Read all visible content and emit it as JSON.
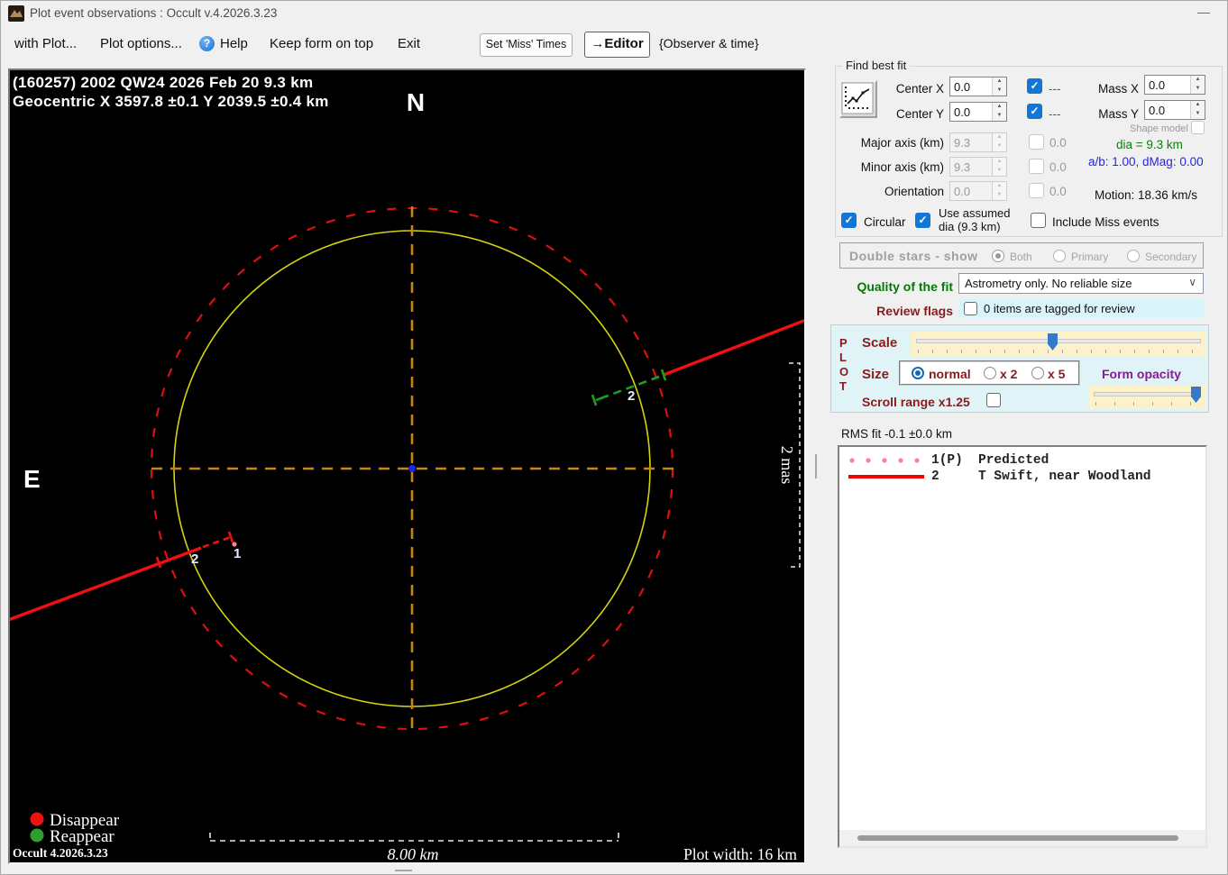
{
  "icons": {
    "help_glyph": "?",
    "check_glyph": "✓",
    "spinner_up": "▲",
    "spinner_down": "▼",
    "combo_chevron": "∨",
    "minimize": "—"
  },
  "window": {
    "title": "Plot event observations : Occult v.4.2026.3.23"
  },
  "menubar": {
    "with_plot": "with Plot...",
    "plot_options": "Plot options...",
    "help": "Help",
    "keep_on_top": "Keep form on top",
    "exit": "Exit",
    "set_miss_times": "Set 'Miss' Times",
    "editor": "→Editor",
    "observer_time": "{Observer & time}"
  },
  "plot": {
    "header_line1": "(160257) 2002 QW24  2026 Feb 20   9.3 km",
    "header_line2": "Geocentric  X 3597.8 ±0.1 Y 2039.5 ±0.4 km",
    "north": "N",
    "east": "E",
    "mas_scale": "2 mas",
    "chord1_label": "1",
    "chord2_label_left": "2",
    "chord2_label_right": "2",
    "legend_disappear": "Disappear",
    "legend_reappear": "Reappear",
    "version": "Occult 4.2026.3.23",
    "scalebar": "8.00 km",
    "plot_width": "Plot width: 16 km"
  },
  "find_best_fit": {
    "group_title": "Find best fit",
    "center_x_label": "Center X",
    "center_x_value": "0.0",
    "center_x_dash": "---",
    "center_y_label": "Center Y",
    "center_y_value": "0.0",
    "center_y_dash": "---",
    "mass_x_label": "Mass X",
    "mass_x_value": "0.0",
    "mass_y_label": "Mass Y",
    "mass_y_value": "0.0",
    "shape_model_label": "Shape model",
    "major_axis_label": "Major axis (km)",
    "major_axis_value": "9.3",
    "major_axis_cb": "0.0",
    "minor_axis_label": "Minor axis (km)",
    "minor_axis_value": "9.3",
    "minor_axis_cb": "0.0",
    "orientation_label": "Orientation",
    "orientation_value": "0.0",
    "orientation_cb": "0.0",
    "dia_text": "dia = 9.3 km",
    "ab_text": "a/b: 1.00, dMag: 0.00",
    "motion_text": "Motion: 18.36 km/s",
    "circular_label": "Circular",
    "use_assumed_line1": "Use assumed",
    "use_assumed_line2": "dia (9.3 km)",
    "include_miss_label": "Include Miss events"
  },
  "double_stars": {
    "title": "Double stars - show",
    "both": "Both",
    "primary": "Primary",
    "secondary": "Secondary"
  },
  "quality": {
    "label": "Quality of the fit",
    "value": "Astrometry only. No reliable size"
  },
  "review": {
    "label": "Review flags",
    "value": "0 items are tagged for review"
  },
  "plot_controls": {
    "vertical_label": [
      "P",
      "L",
      "O",
      "T"
    ],
    "scale_label": "Scale",
    "size_label": "Size",
    "size_options": [
      "normal",
      "x 2",
      "x 5"
    ],
    "form_opacity_label": "Form opacity",
    "scroll_range_label": "Scroll range x1.25"
  },
  "rms": {
    "text": "RMS fit -0.1 ±0.0 km"
  },
  "observations": {
    "rows": [
      {
        "id": "1(P)",
        "name": "Predicted"
      },
      {
        "id": "2",
        "name": "T Swift, near Woodland"
      }
    ]
  }
}
